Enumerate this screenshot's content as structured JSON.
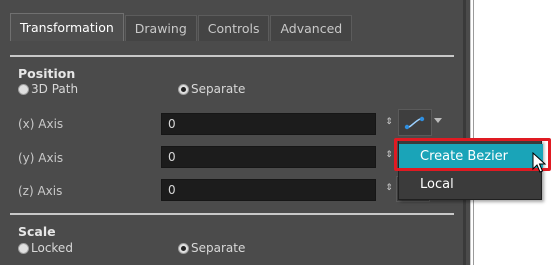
{
  "tabs": [
    {
      "label": "Transformation",
      "active": true
    },
    {
      "label": "Drawing",
      "active": false
    },
    {
      "label": "Controls",
      "active": false
    },
    {
      "label": "Advanced",
      "active": false
    }
  ],
  "position": {
    "title": "Position",
    "option_3d_path": "3D Path",
    "option_separate": "Separate",
    "selected": "Separate"
  },
  "axes": [
    {
      "label": "(x) Axis",
      "value": "0"
    },
    {
      "label": "(y) Axis",
      "value": "0"
    },
    {
      "label": "(z) Axis",
      "value": "0"
    }
  ],
  "stepper_glyph": "⇕",
  "menu": {
    "items": [
      "Create Bezier",
      "Local"
    ],
    "highlighted": "Create Bezier"
  },
  "scale": {
    "title": "Scale",
    "option_locked": "Locked",
    "option_separate": "Separate",
    "selected": "Separate"
  },
  "colors": {
    "panel_bg": "#4b4b4b",
    "field_bg": "#1c1c1c",
    "menu_highlight": "#1aa4b8",
    "callout_red": "#e01a22"
  }
}
